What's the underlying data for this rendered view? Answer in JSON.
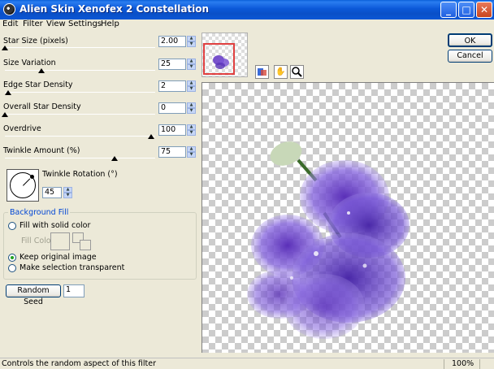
{
  "window": {
    "title": "Alien Skin Xenofex 2 Constellation",
    "minimize_glyph": "_",
    "maximize_glyph": "□",
    "close_glyph": "✕"
  },
  "menu": [
    "Edit",
    "Filter",
    "View",
    "Settings",
    "Help"
  ],
  "params": {
    "star_size": {
      "label": "Star Size (pixels)",
      "value": "2.00",
      "level": 0.0
    },
    "size_variation": {
      "label": "Size Variation",
      "value": "25",
      "level": 0.25
    },
    "edge_star_density": {
      "label": "Edge Star Density",
      "value": "2",
      "level": 0.02
    },
    "overall_star_density": {
      "label": "Overall Star Density",
      "value": "0",
      "level": 0.0
    },
    "overdrive": {
      "label": "Overdrive",
      "value": "100",
      "level": 1.0
    },
    "twinkle_amount": {
      "label": "Twinkle Amount (%)",
      "value": "75",
      "level": 0.75
    }
  },
  "twinkle_rotation": {
    "label": "Twinkle Rotation (°)",
    "value": "45"
  },
  "background_fill": {
    "title": "Background Fill",
    "fill_solid_label": "Fill with solid color",
    "fill_color_label": "Fill Color",
    "keep_original_label": "Keep original image",
    "transparent_label": "Make selection transparent",
    "selected": "keep_original"
  },
  "random_seed": {
    "button_label": "Random Seed",
    "value": "1"
  },
  "buttons": {
    "ok": "OK",
    "cancel": "Cancel"
  },
  "tools": {
    "preview_toggle": "preview-toggle-icon",
    "pan": "hand-icon",
    "zoom": "zoom-icon"
  },
  "status": {
    "help_text": "Controls the random aspect of this filter",
    "zoom": "100%"
  }
}
